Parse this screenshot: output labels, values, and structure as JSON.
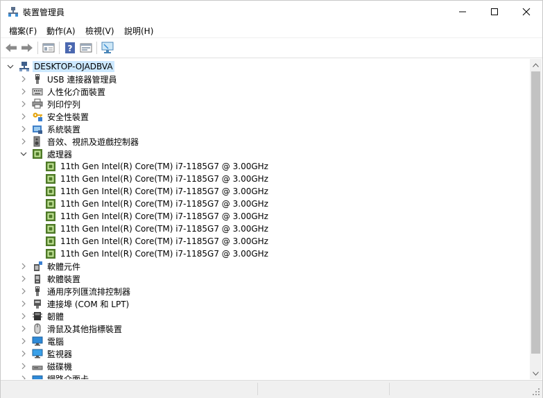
{
  "window": {
    "title": "裝置管理員",
    "icon": "device-manager-icon"
  },
  "window_controls": {
    "minimize": "—",
    "maximize": "☐",
    "close": "✕"
  },
  "menu": [
    "檔案(F)",
    "動作(A)",
    "檢視(V)",
    "說明(H)"
  ],
  "toolbar": [
    "back-arrow-icon",
    "forward-arrow-icon",
    "properties-icon",
    "help-icon",
    "update-driver-icon",
    "scan-hardware-icon"
  ],
  "tree": {
    "root": {
      "label": "DESKTOP-OJADBVA",
      "icon": "computer-icon",
      "expanded": true
    },
    "categories": [
      {
        "label": "USB 連接器管理員",
        "icon": "usb-icon",
        "expanded": false
      },
      {
        "label": "人性化介面裝置",
        "icon": "keyboard-icon",
        "expanded": false
      },
      {
        "label": "列印佇列",
        "icon": "printer-icon",
        "expanded": false
      },
      {
        "label": "安全性裝置",
        "icon": "security-key-icon",
        "expanded": false
      },
      {
        "label": "系統裝置",
        "icon": "system-folder-icon",
        "expanded": false
      },
      {
        "label": "音效、視訊及遊戲控制器",
        "icon": "speaker-icon",
        "expanded": false
      },
      {
        "label": "處理器",
        "icon": "processor-icon",
        "expanded": true,
        "children": [
          "11th Gen Intel(R) Core(TM) i7-1185G7 @ 3.00GHz",
          "11th Gen Intel(R) Core(TM) i7-1185G7 @ 3.00GHz",
          "11th Gen Intel(R) Core(TM) i7-1185G7 @ 3.00GHz",
          "11th Gen Intel(R) Core(TM) i7-1185G7 @ 3.00GHz",
          "11th Gen Intel(R) Core(TM) i7-1185G7 @ 3.00GHz",
          "11th Gen Intel(R) Core(TM) i7-1185G7 @ 3.00GHz",
          "11th Gen Intel(R) Core(TM) i7-1185G7 @ 3.00GHz",
          "11th Gen Intel(R) Core(TM) i7-1185G7 @ 3.00GHz"
        ]
      },
      {
        "label": "軟體元件",
        "icon": "software-component-icon",
        "expanded": false
      },
      {
        "label": "軟體裝置",
        "icon": "software-device-icon",
        "expanded": false
      },
      {
        "label": "通用序列匯流排控制器",
        "icon": "usb-controller-icon",
        "expanded": false
      },
      {
        "label": "連接埠 (COM 和 LPT)",
        "icon": "port-icon",
        "expanded": false
      },
      {
        "label": "韌體",
        "icon": "firmware-icon",
        "expanded": false
      },
      {
        "label": "滑鼠及其他指標裝置",
        "icon": "mouse-icon",
        "expanded": false
      },
      {
        "label": "電腦",
        "icon": "monitor-computer-icon",
        "expanded": false
      },
      {
        "label": "監視器",
        "icon": "monitor-icon",
        "expanded": false
      },
      {
        "label": "磁碟機",
        "icon": "disk-drive-icon",
        "expanded": false
      },
      {
        "label": "網路介面卡",
        "icon": "network-adapter-icon",
        "expanded": false
      }
    ]
  },
  "colors": {
    "selection": "#cce8ff",
    "chip": "#4f7a28",
    "chip_inner": "#c7e89c"
  }
}
